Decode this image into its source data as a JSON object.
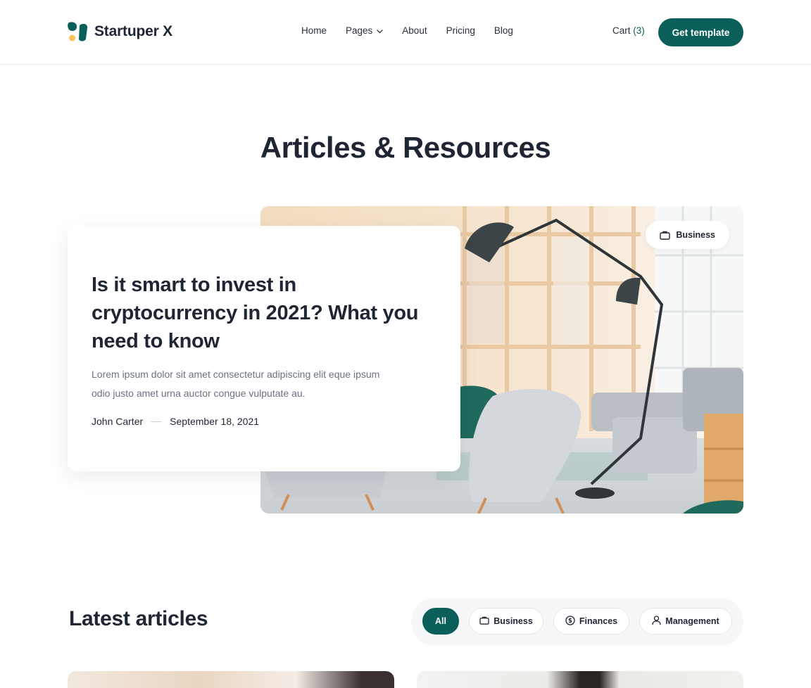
{
  "brand": {
    "name": "Startuper X",
    "accent": "#0b5f5a",
    "dot": "#f5c45a"
  },
  "nav": {
    "items": [
      {
        "label": "Home"
      },
      {
        "label": "Pages",
        "has_dropdown": true,
        "icon": "chevron-down-icon"
      },
      {
        "label": "About"
      },
      {
        "label": "Pricing"
      },
      {
        "label": "Blog"
      }
    ],
    "cart_label": "Cart",
    "cart_count": "(3)",
    "cta_label": "Get template"
  },
  "hero": {
    "title": "Articles & Resources",
    "featured": {
      "category": "Business",
      "category_icon": "briefcase-icon",
      "title": "Is it smart to invest in cryptocurrency in 2021?  What you need to know",
      "excerpt": "Lorem ipsum dolor sit amet consectetur adipiscing elit eque ipsum odio justo amet urna auctor congue vulputate au.",
      "author": "John Carter",
      "date": "September 18, 2021"
    }
  },
  "latest": {
    "title": "Latest articles",
    "filters": [
      {
        "label": "All",
        "active": true,
        "icon": ""
      },
      {
        "label": "Business",
        "active": false,
        "icon": "briefcase-icon"
      },
      {
        "label": "Finances",
        "active": false,
        "icon": "dollar-circle-icon"
      },
      {
        "label": "Management",
        "active": false,
        "icon": "user-icon"
      }
    ]
  }
}
